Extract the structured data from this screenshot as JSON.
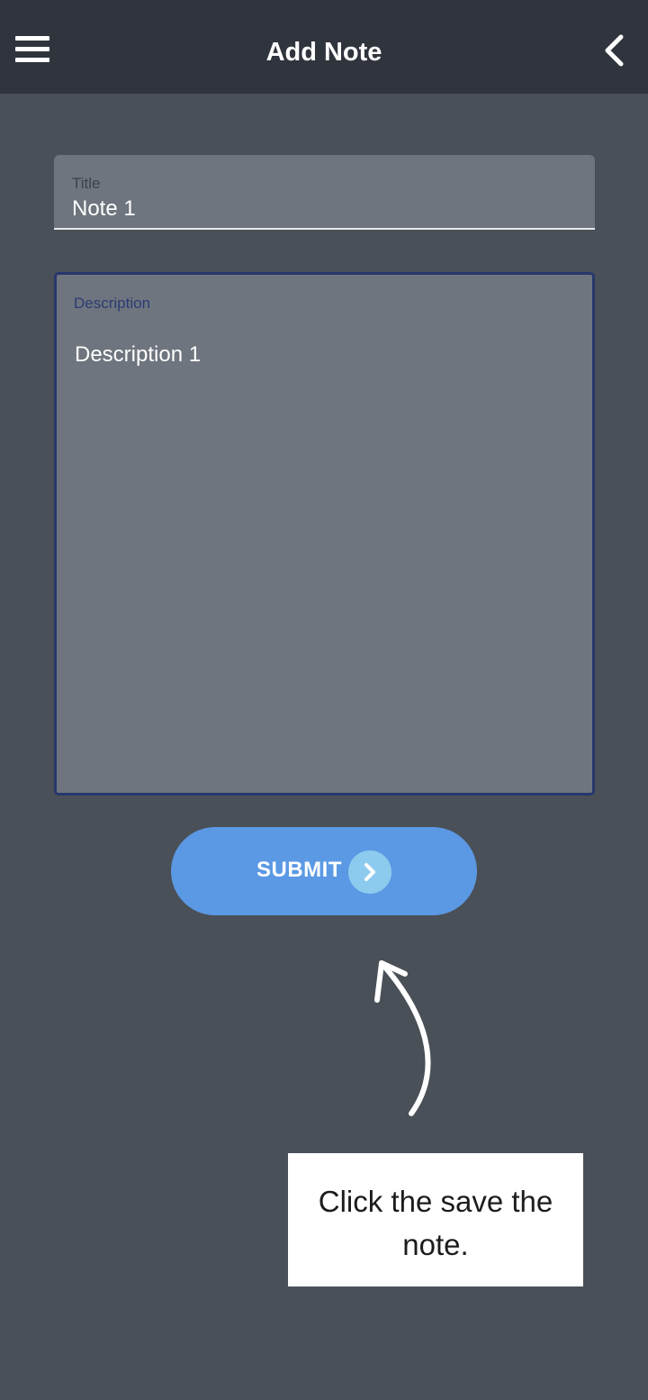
{
  "header": {
    "title": "Add Note",
    "menu_icon": "hamburger-menu-icon",
    "back_icon": "chevron-left-icon"
  },
  "form": {
    "title_field": {
      "label": "Title",
      "value": "Note 1"
    },
    "description_field": {
      "label": "Description",
      "value": "Description 1"
    },
    "submit": {
      "label": "SUBMIT",
      "icon": "chevron-right-circle-icon"
    }
  },
  "annotation": {
    "text": "Click the save the note.",
    "icon": "curved-arrow-icon"
  },
  "colors": {
    "appbar": "#30343d",
    "background": "#4a5058",
    "field": "#6e757e",
    "accent": "#5b99e4",
    "focus_border": "#27376e"
  }
}
